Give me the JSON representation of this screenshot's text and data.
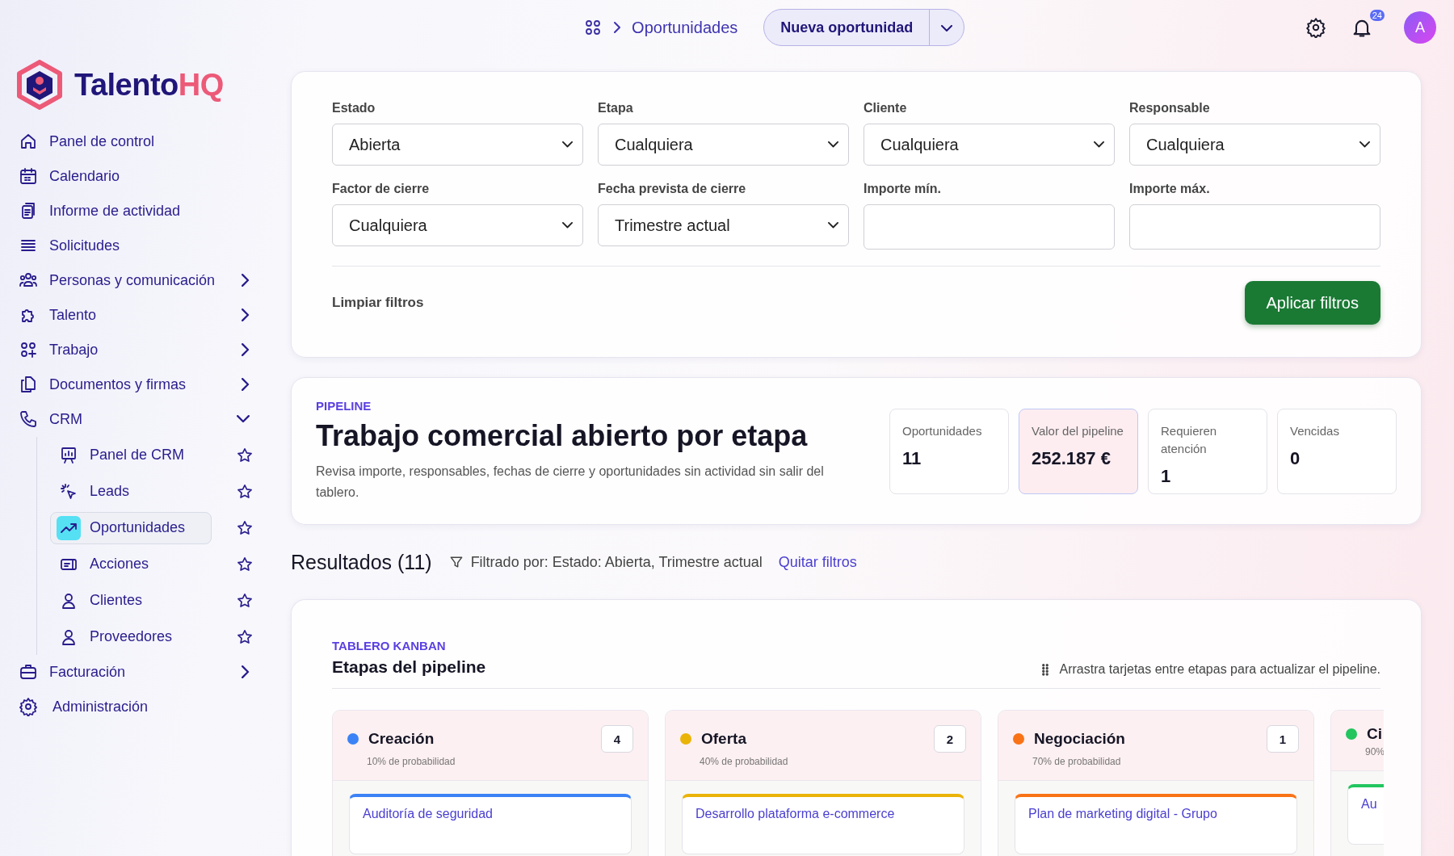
{
  "logo": {
    "text": "Talento",
    "accent": "HQ"
  },
  "sidebar": {
    "items": [
      {
        "label": "Panel de control",
        "selected": false
      },
      {
        "label": "Calendario",
        "selected": false
      },
      {
        "label": "Informe de actividad",
        "selected": false
      },
      {
        "label": "Solicitudes",
        "selected": false
      },
      {
        "label": "Personas y comunicación",
        "selected": false,
        "expanded": false
      },
      {
        "label": "Talento",
        "selected": false,
        "expanded": false
      },
      {
        "label": "Trabajo",
        "selected": false,
        "expanded": false
      },
      {
        "label": "Documentos y firmas",
        "selected": false,
        "expanded": false
      },
      {
        "label": "CRM",
        "selected": false,
        "expanded": true,
        "children": [
          {
            "label": "Panel de CRM",
            "selected": false,
            "favorite": false
          },
          {
            "label": "Leads",
            "selected": false,
            "favorite": false
          },
          {
            "label": "Oportunidades",
            "selected": true,
            "favorite": false
          },
          {
            "label": "Acciones",
            "selected": false,
            "favorite": false
          },
          {
            "label": "Clientes",
            "selected": false,
            "favorite": false
          },
          {
            "label": "Proveedores",
            "selected": false,
            "favorite": false
          }
        ]
      },
      {
        "label": "Facturación",
        "selected": false,
        "expanded": false
      },
      {
        "label": "Administración",
        "selected": false
      }
    ]
  },
  "topbar": {
    "breadcrumb": "Oportunidades",
    "primary_action": "Nueva oportunidad",
    "notification_count": "24",
    "avatar_initial": "A"
  },
  "filters": {
    "fields": [
      {
        "label": "Estado",
        "kind": "select",
        "value": "Abierta"
      },
      {
        "label": "Etapa",
        "kind": "select",
        "value": "Cualquiera"
      },
      {
        "label": "Cliente",
        "kind": "select",
        "value": "Cualquiera"
      },
      {
        "label": "Responsable",
        "kind": "select",
        "value": "Cualquiera"
      },
      {
        "label": "Factor de cierre",
        "kind": "select",
        "value": "Cualquiera"
      },
      {
        "label": "Fecha prevista de cierre",
        "kind": "select",
        "value": "Trimestre actual"
      },
      {
        "label": "Importe mín.",
        "kind": "input"
      },
      {
        "label": "Importe máx.",
        "kind": "input"
      }
    ],
    "clear": "Limpiar filtros",
    "apply": "Aplicar filtros"
  },
  "pipeline": {
    "eyebrow": "PIPELINE",
    "title": "Trabajo comercial abierto por etapa",
    "description": "Revisa importe, responsables, fechas de cierre y oportunidades sin actividad sin salir del tablero.",
    "stats": [
      {
        "label": "Oportunidades",
        "value": "11",
        "highlighted": false
      },
      {
        "label": "Valor del pipeline",
        "value": "252.187 €",
        "highlighted": true
      },
      {
        "label": "Requieren atención",
        "value": "1",
        "highlighted": false
      },
      {
        "label": "Vencidas",
        "value": "0",
        "highlighted": false
      }
    ]
  },
  "results": {
    "title": "Resultados (11)",
    "filter_note": "Filtrado por: Estado: Abierta, Trimestre actual",
    "clear_link": "Quitar filtros"
  },
  "kanban": {
    "eyebrow": "TABLERO KANBAN",
    "title": "Etapas del pipeline",
    "hint": "Arrastra tarjetas entre etapas para actualizar el pipeline.",
    "columns": [
      {
        "name": "Creación",
        "color": "#3b82f6",
        "probability": "10% de probabilidad",
        "count": "4",
        "cards": [
          {
            "title": "Auditoría de seguridad"
          }
        ]
      },
      {
        "name": "Oferta",
        "color": "#eab308",
        "probability": "40% de probabilidad",
        "count": "2",
        "cards": [
          {
            "title": "Desarrollo plataforma e-commerce"
          }
        ]
      },
      {
        "name": "Negociación",
        "color": "#f97316",
        "probability": "70% de probabilidad",
        "count": "1",
        "cards": [
          {
            "title": "Plan de marketing digital - Grupo"
          }
        ]
      },
      {
        "name": "Ci",
        "color": "#22c55e",
        "probability": "90%",
        "cards": [
          {
            "title": "Au"
          }
        ]
      }
    ]
  }
}
